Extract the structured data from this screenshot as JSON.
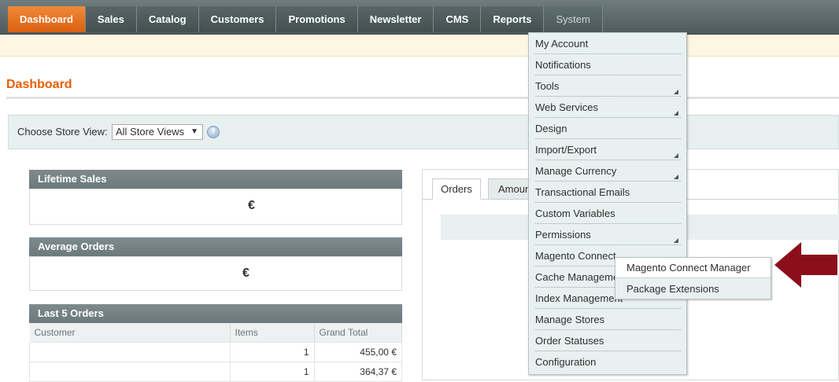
{
  "nav": {
    "items": [
      "Dashboard",
      "Sales",
      "Catalog",
      "Customers",
      "Promotions",
      "Newsletter",
      "CMS",
      "Reports",
      "System"
    ]
  },
  "page": {
    "title": "Dashboard"
  },
  "store_switcher": {
    "label": "Choose Store View:",
    "selected": "All Store Views",
    "help_icon": "help-icon"
  },
  "lifetime_sales": {
    "title": "Lifetime Sales",
    "value": "€"
  },
  "average_orders": {
    "title": "Average Orders",
    "value": "€"
  },
  "last_orders": {
    "title": "Last 5 Orders",
    "columns": [
      "Customer",
      "Items",
      "Grand Total"
    ],
    "rows": [
      {
        "customer": "",
        "items": "1",
        "total": "455,00 €"
      },
      {
        "customer": "",
        "items": "1",
        "total": "364,37 €"
      }
    ]
  },
  "tabs": [
    "Orders",
    "Amounts"
  ],
  "system_menu": {
    "items": [
      {
        "label": "My Account",
        "submenu": false
      },
      {
        "label": "Notifications",
        "submenu": false
      },
      {
        "label": "Tools",
        "submenu": true
      },
      {
        "label": "Web Services",
        "submenu": true
      },
      {
        "label": "Design",
        "submenu": false
      },
      {
        "label": "Import/Export",
        "submenu": true
      },
      {
        "label": "Manage Currency",
        "submenu": true
      },
      {
        "label": "Transactional Emails",
        "submenu": false
      },
      {
        "label": "Custom Variables",
        "submenu": false
      },
      {
        "label": "Permissions",
        "submenu": true
      },
      {
        "label": "Magento Connect",
        "submenu": false
      },
      {
        "label": "Cache Management",
        "submenu": false
      },
      {
        "label": "Index Management",
        "submenu": false
      },
      {
        "label": "Manage Stores",
        "submenu": false
      },
      {
        "label": "Order Statuses",
        "submenu": false
      },
      {
        "label": "Configuration",
        "submenu": false
      }
    ]
  },
  "connect_submenu": {
    "items": [
      "Magento Connect Manager",
      "Package Extensions"
    ]
  },
  "colors": {
    "accent": "#eb5e00",
    "callout_arrow": "#8b0f1a"
  }
}
